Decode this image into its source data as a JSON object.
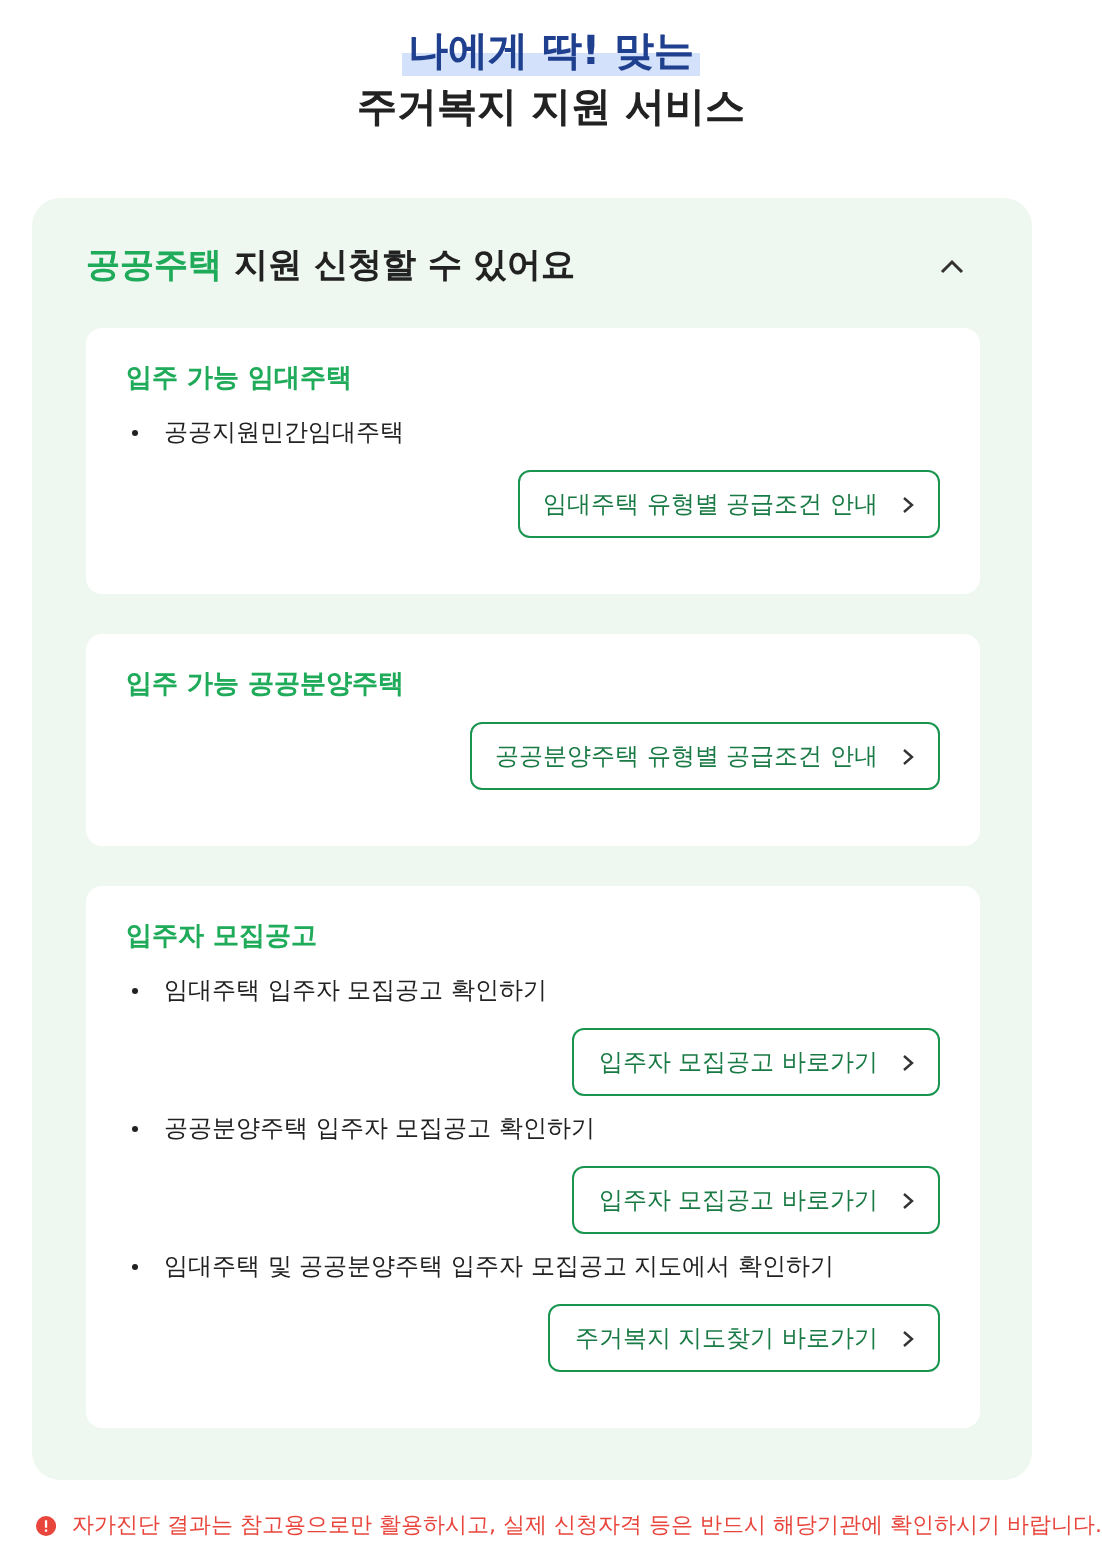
{
  "header": {
    "highlight": "나에게 딱! 맞는",
    "title": "주거복지 지원 서비스"
  },
  "panel": {
    "title_accent": "공공주택",
    "title_rest": "지원 신청할 수 있어요",
    "expanded": true,
    "cards": [
      {
        "title": "입주 가능 임대주택",
        "entries": [
          {
            "kind": "bullet",
            "text": "공공지원민간임대주택"
          },
          {
            "kind": "link",
            "text": "임대주택 유형별 공급조건 안내"
          }
        ]
      },
      {
        "title": "입주 가능 공공분양주택",
        "entries": [
          {
            "kind": "link",
            "text": "공공분양주택 유형별 공급조건 안내"
          }
        ]
      },
      {
        "title": "입주자 모집공고",
        "entries": [
          {
            "kind": "bullet",
            "text": "임대주택 입주자 모집공고 확인하기"
          },
          {
            "kind": "link",
            "text": "입주자 모집공고 바로가기"
          },
          {
            "kind": "bullet",
            "text": "공공분양주택 입주자 모집공고 확인하기"
          },
          {
            "kind": "link",
            "text": "입주자 모집공고 바로가기"
          },
          {
            "kind": "bullet",
            "text": "임대주택 및 공공분양주택 입주자 모집공고 지도에서 확인하기"
          },
          {
            "kind": "link",
            "text": "주거복지 지도찾기 바로가기"
          }
        ]
      }
    ]
  },
  "notice": "자가진단 결과는 참고용으로만 활용하시고, 실제 신청자격 등은 반드시 해당기관에 확인하시기 바랍니다."
}
